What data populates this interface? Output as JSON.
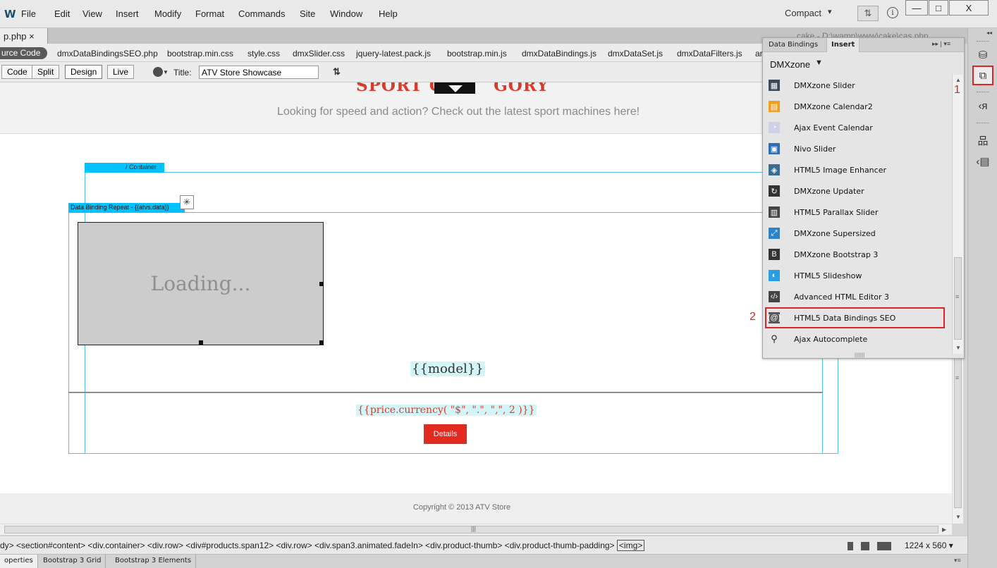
{
  "app": {
    "logo": "W",
    "menu": [
      "File",
      "Edit",
      "View",
      "Insert",
      "Modify",
      "Format",
      "Commands",
      "Site",
      "Window",
      "Help"
    ],
    "workspace": "Compact",
    "workspace_arrow": "▾",
    "sync_glyph": "⇅",
    "info_glyph": "i"
  },
  "window_controls": {
    "minimize": "—",
    "maximize": "□",
    "close": "X"
  },
  "document": {
    "tab_label": "p.php ×",
    "path": "cake - D:\\wamp\\www\\cake\\cas.php"
  },
  "related_files": {
    "source_code": "urce Code",
    "files": [
      "dmxDataBindingsSEO.php",
      "bootstrap.min.css",
      "style.css",
      "dmxSlider.css",
      "jquery-latest.pack.js",
      "bootstrap.min.js",
      "dmxDataBindings.js",
      "dmxDataSet.js",
      "dmxDataFilters.js",
      "ar"
    ]
  },
  "doc_toolbar": {
    "code": "Code",
    "split": "Split",
    "design": "Design",
    "live": "Live",
    "title_label": "Title:",
    "title_value": "ATV Store Showcase",
    "sort_glyph": "⇅"
  },
  "page": {
    "heading": "SPORT C",
    "heading_end": "GORY",
    "tagline": "Looking for speed and action? Check out the latest sport machines here!",
    "container_label": "/ Container",
    "repeat_label": "Data Binding Repeat - {{atvs.data}}",
    "loading": "Loading...",
    "model": "{{model}}",
    "price": "{{price.currency( \"$\", \".\", \",\", 2 )}}",
    "details": "Details",
    "copyright": "Copyright © 2013 ATV Store"
  },
  "status_bar": {
    "tags": "dy> <section#content> <div.container> <div.row> <div#products.span12> <div.row> <div.span3.animated.fadeIn> <div.product-thumb> <div.product-thumb-padding>",
    "img_tag": "<img>",
    "window_size": "1224 x 560 ▾"
  },
  "panel_tabs": [
    "operties",
    "Bootstrap 3 Grid",
    "Bootstrap 3 Elements"
  ],
  "insert_panel": {
    "tabs": [
      "Data Bindings",
      "Insert"
    ],
    "category": "DMXzone",
    "items": [
      {
        "label": "DMXzone Slider",
        "icon": "slider-icon",
        "color": "#3b4a5a"
      },
      {
        "label": "DMXzone Calendar2",
        "icon": "calendar-icon",
        "color": "#f0a020"
      },
      {
        "label": "Ajax Event Calendar",
        "icon": "event-calendar-icon",
        "color": "#d0d0e8"
      },
      {
        "label": "Nivo Slider",
        "icon": "nivo-icon",
        "color": "#2a6ebb"
      },
      {
        "label": "HTML5 Image Enhancer",
        "icon": "image-enhancer-icon",
        "color": "#3a6e8f"
      },
      {
        "label": "DMXzone Updater",
        "icon": "updater-icon",
        "color": "#333333"
      },
      {
        "label": "HTML5 Parallax Slider",
        "icon": "parallax-icon",
        "color": "#444444"
      },
      {
        "label": "DMXzone Supersized",
        "icon": "supersized-icon",
        "color": "#2a84c8"
      },
      {
        "label": "DMXzone Bootstrap 3",
        "icon": "bootstrap-icon",
        "color": "#333333"
      },
      {
        "label": "HTML5 Slideshow",
        "icon": "slideshow-icon",
        "color": "#2a9ee0"
      },
      {
        "label": "Advanced HTML Editor 3",
        "icon": "html-editor-icon",
        "color": "#444444"
      },
      {
        "label": "HTML5 Data Bindings SEO",
        "icon": "data-bindings-seo-icon",
        "color": "#555555"
      },
      {
        "label": "Ajax Autocomplete",
        "icon": "search-icon",
        "color": "#222222"
      }
    ]
  },
  "annotations": [
    "1",
    "2"
  ],
  "accent_colors": {
    "highlight": "#e02424",
    "selection": "#00c2ff",
    "brand_red": "#d93a2c"
  }
}
